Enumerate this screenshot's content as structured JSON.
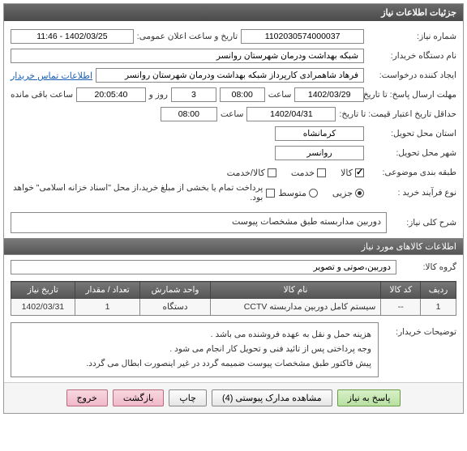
{
  "panel_title": "جزئیات اطلاعات نیاز",
  "fields": {
    "need_no_label": "شماره نیاز:",
    "need_no": "1102030574000037",
    "announce_label": "تاریخ و ساعت اعلان عمومی:",
    "announce": "1402/03/25 - 11:46",
    "buyer_label": "نام دستگاه خریدار:",
    "buyer": "شبکه بهداشت ودرمان شهرستان روانسر",
    "creator_label": "ایجاد کننده درخواست:",
    "creator": "فرهاد شاهمرادی کارپرداز شبکه بهداشت ودرمان شهرستان روانسر",
    "contact_link": "اطلاعات تماس خریدار",
    "deadline_label": "مهلت ارسال پاسخ: تا تاریخ:",
    "deadline_date": "1402/03/29",
    "time_label": "ساعت",
    "deadline_time": "08:00",
    "days_label": "روز و",
    "days": "3",
    "remain_time": "20:05:40",
    "remain_label": "ساعت باقی مانده",
    "credit_label": "حداقل تاریخ اعتبار قیمت: تا تاریخ:",
    "credit_date": "1402/04/31",
    "credit_time": "08:00",
    "province_label": "استان محل تحویل:",
    "province": "کرمانشاه",
    "city_label": "شهر محل تحویل:",
    "city": "روانسر",
    "subject_class_label": "طبقه بندی موضوعی:",
    "class_good": "کالا",
    "class_service": "خدمت",
    "class_both": "کالا/خدمت",
    "buy_type_label": "نوع فرآیند خرید :",
    "buy_small": "جزیی",
    "buy_medium": "متوسط",
    "pay_note": "پرداخت تمام یا بخشی از مبلغ خرید،از محل \"اسناد خزانه اسلامی\" خواهد بود."
  },
  "desc": {
    "label": "شرح کلی نیاز:",
    "text": "دوربین مداربسته طبق مشخصات پیوست"
  },
  "items_section": "اطلاعات کالاهای مورد نیاز",
  "group": {
    "label": "گروه کالا:",
    "value": "دوربین،صوتی و تصویر"
  },
  "table": {
    "headers": [
      "ردیف",
      "کد کالا",
      "نام کالا",
      "واحد شمارش",
      "تعداد / مقدار",
      "تاریخ نیاز"
    ],
    "rows": [
      {
        "idx": "1",
        "code": "--",
        "name": "سیستم کامل دوربین مداربسته CCTV",
        "unit": "دستگاه",
        "qty": "1",
        "date": "1402/03/31"
      }
    ]
  },
  "buyer_notes": {
    "label": "توضیحات خریدار:",
    "lines": [
      "هزینه حمل و نقل به عهده فروشنده می باشد .",
      "وجه پرداختی پس از تائید فنی و تحویل کار انجام می شود .",
      "پیش فاکتور طبق مشخصات پیوست ضمیمه گردد در غیر اینصورت ابطال می گردد."
    ]
  },
  "buttons": {
    "reply": "پاسخ به نیاز",
    "attachments": "مشاهده مدارک پیوستی (4)",
    "print": "چاپ",
    "back": "بازگشت",
    "exit": "خروج"
  }
}
